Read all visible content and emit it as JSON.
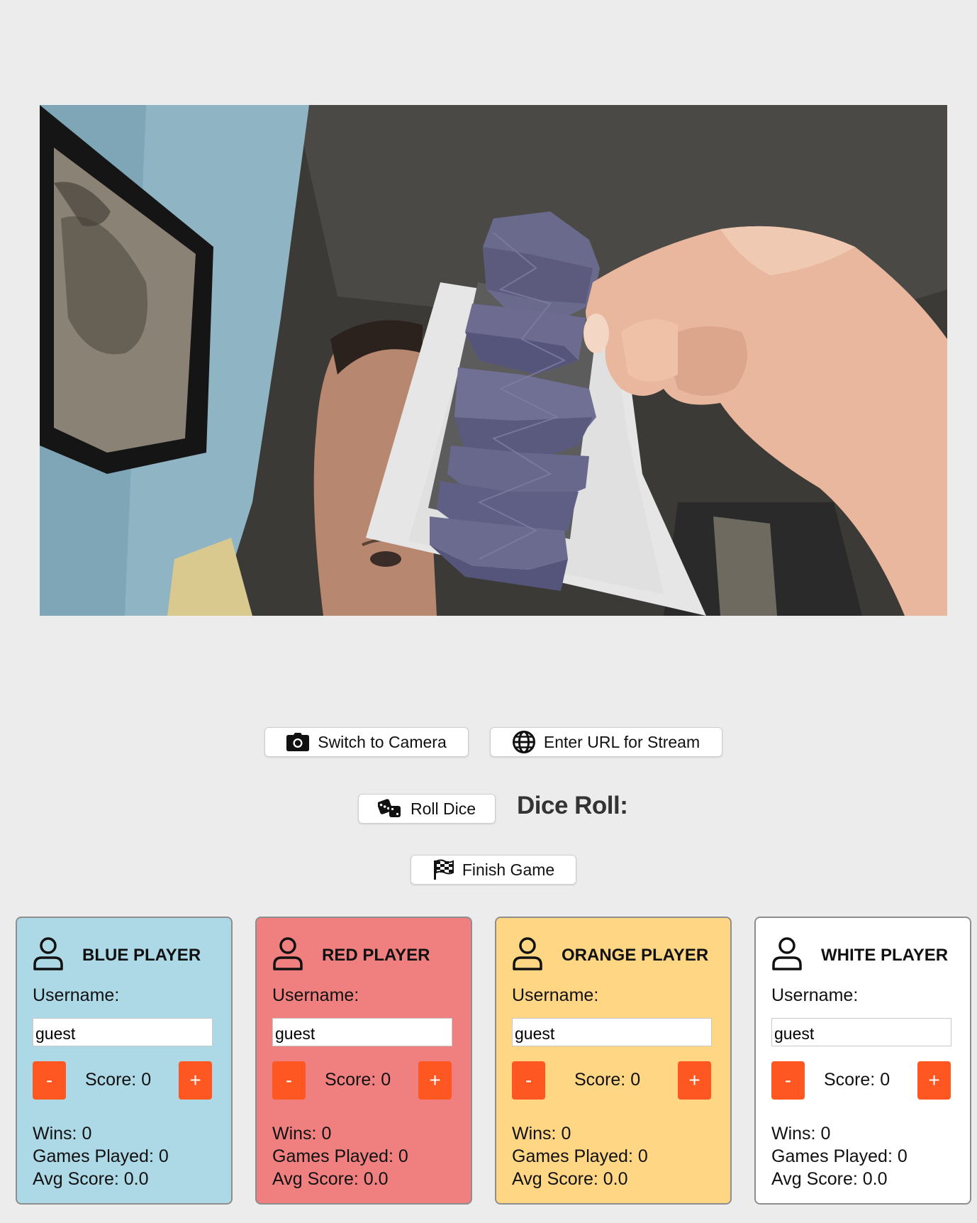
{
  "controls": {
    "switch_camera": "Switch to Camera",
    "enter_url": "Enter URL for Stream",
    "roll_dice": "Roll Dice",
    "dice_roll_label": "Dice Roll:",
    "finish_game": "Finish Game"
  },
  "players": [
    {
      "title": "BLUE PLAYER",
      "color": "#add8e6",
      "username_label": "Username:",
      "username": "guest",
      "minus": "-",
      "plus": "+",
      "score": "Score: 0",
      "wins": "Wins: 0",
      "games_played": "Games Played: 0",
      "avg_score": "Avg Score: 0.0"
    },
    {
      "title": "RED PLAYER",
      "color": "#f08080",
      "username_label": "Username:",
      "username": "guest",
      "minus": "-",
      "plus": "+",
      "score": "Score: 0",
      "wins": "Wins: 0",
      "games_played": "Games Played: 0",
      "avg_score": "Avg Score: 0.0"
    },
    {
      "title": "ORANGE PLAYER",
      "color": "#ffd684",
      "username_label": "Username:",
      "username": "guest",
      "minus": "-",
      "plus": "+",
      "score": "Score: 0",
      "wins": "Wins: 0",
      "games_played": "Games Played: 0",
      "avg_score": "Avg Score: 0.0"
    },
    {
      "title": "WHITE PLAYER",
      "color": "#ffffff",
      "username_label": "Username:",
      "username": "guest",
      "minus": "-",
      "plus": "+",
      "score": "Score: 0",
      "wins": "Wins: 0",
      "games_played": "Games Played: 0",
      "avg_score": "Avg Score: 0.0"
    }
  ],
  "icons": {
    "camera": "camera-icon",
    "globe": "globe-icon",
    "dice": "dice-icon",
    "flag": "checkered-flag-icon",
    "user": "user-icon"
  },
  "accent_color": "#ff5722"
}
